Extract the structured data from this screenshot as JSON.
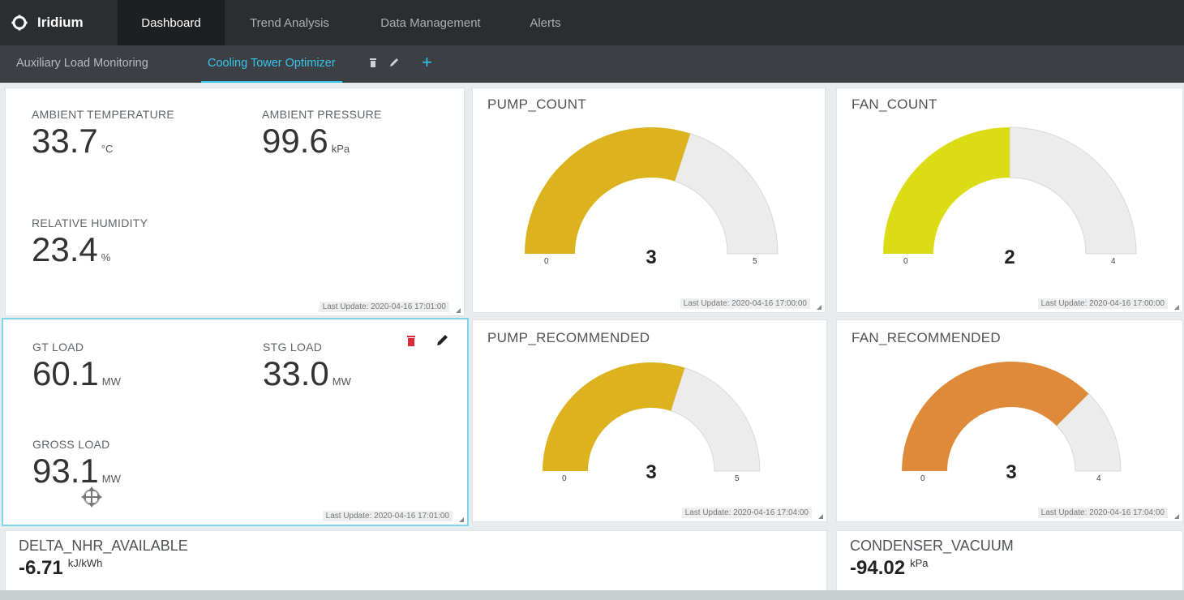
{
  "app": {
    "name": "Iridium"
  },
  "nav": {
    "tabs": [
      "Dashboard",
      "Trend Analysis",
      "Data Management",
      "Alerts"
    ],
    "active": 0
  },
  "subnav": {
    "tabs": [
      "Auxiliary Load Monitoring",
      "Cooling Tower Optimizer"
    ],
    "active": 1
  },
  "ambient_card": {
    "ambient_temperature": {
      "label": "AMBIENT TEMPERATURE",
      "value": "33.7",
      "unit": "°C"
    },
    "ambient_pressure": {
      "label": "AMBIENT PRESSURE",
      "value": "99.6",
      "unit": "kPa"
    },
    "relative_humidity": {
      "label": "RELATIVE HUMIDITY",
      "value": "23.4",
      "unit": "%"
    },
    "last_update": "Last Update: 2020-04-16 17:01:00"
  },
  "load_card": {
    "gt_load": {
      "label": "GT LOAD",
      "value": "60.1",
      "unit": "MW"
    },
    "stg_load": {
      "label": "STG LOAD",
      "value": "33.0",
      "unit": "MW"
    },
    "gross_load": {
      "label": "GROSS LOAD",
      "value": "93.1",
      "unit": "MW"
    },
    "last_update": "Last Update: 2020-04-16 17:01:00"
  },
  "gauges": {
    "pump_count": {
      "title": "PUMP_COUNT",
      "value": "3",
      "min": "0",
      "max": "5",
      "fraction": 0.6,
      "color": "#dcb21e",
      "last_update": "Last Update: 2020-04-16 17:00:00"
    },
    "fan_count": {
      "title": "FAN_COUNT",
      "value": "2",
      "min": "0",
      "max": "4",
      "fraction": 0.5,
      "color": "#dcdc14",
      "last_update": "Last Update: 2020-04-16 17:00:00"
    },
    "pump_recommended": {
      "title": "PUMP_RECOMMENDED",
      "value": "3",
      "min": "0",
      "max": "5",
      "fraction": 0.6,
      "color": "#dcb21e",
      "last_update": "Last Update: 2020-04-16 17:04:00"
    },
    "fan_recommended": {
      "title": "FAN_RECOMMENDED",
      "value": "3",
      "min": "0",
      "max": "4",
      "fraction": 0.75,
      "color": "#df8a38",
      "last_update": "Last Update: 2020-04-16 17:04:00"
    }
  },
  "bottom": {
    "delta_nhr": {
      "title": "DELTA_NHR_AVAILABLE",
      "value": "-6.71",
      "unit": "kJ/kWh"
    },
    "condenser_vacuum": {
      "title": "CONDENSER_VACUUM",
      "value": "-94.02",
      "unit": "kPa"
    }
  }
}
